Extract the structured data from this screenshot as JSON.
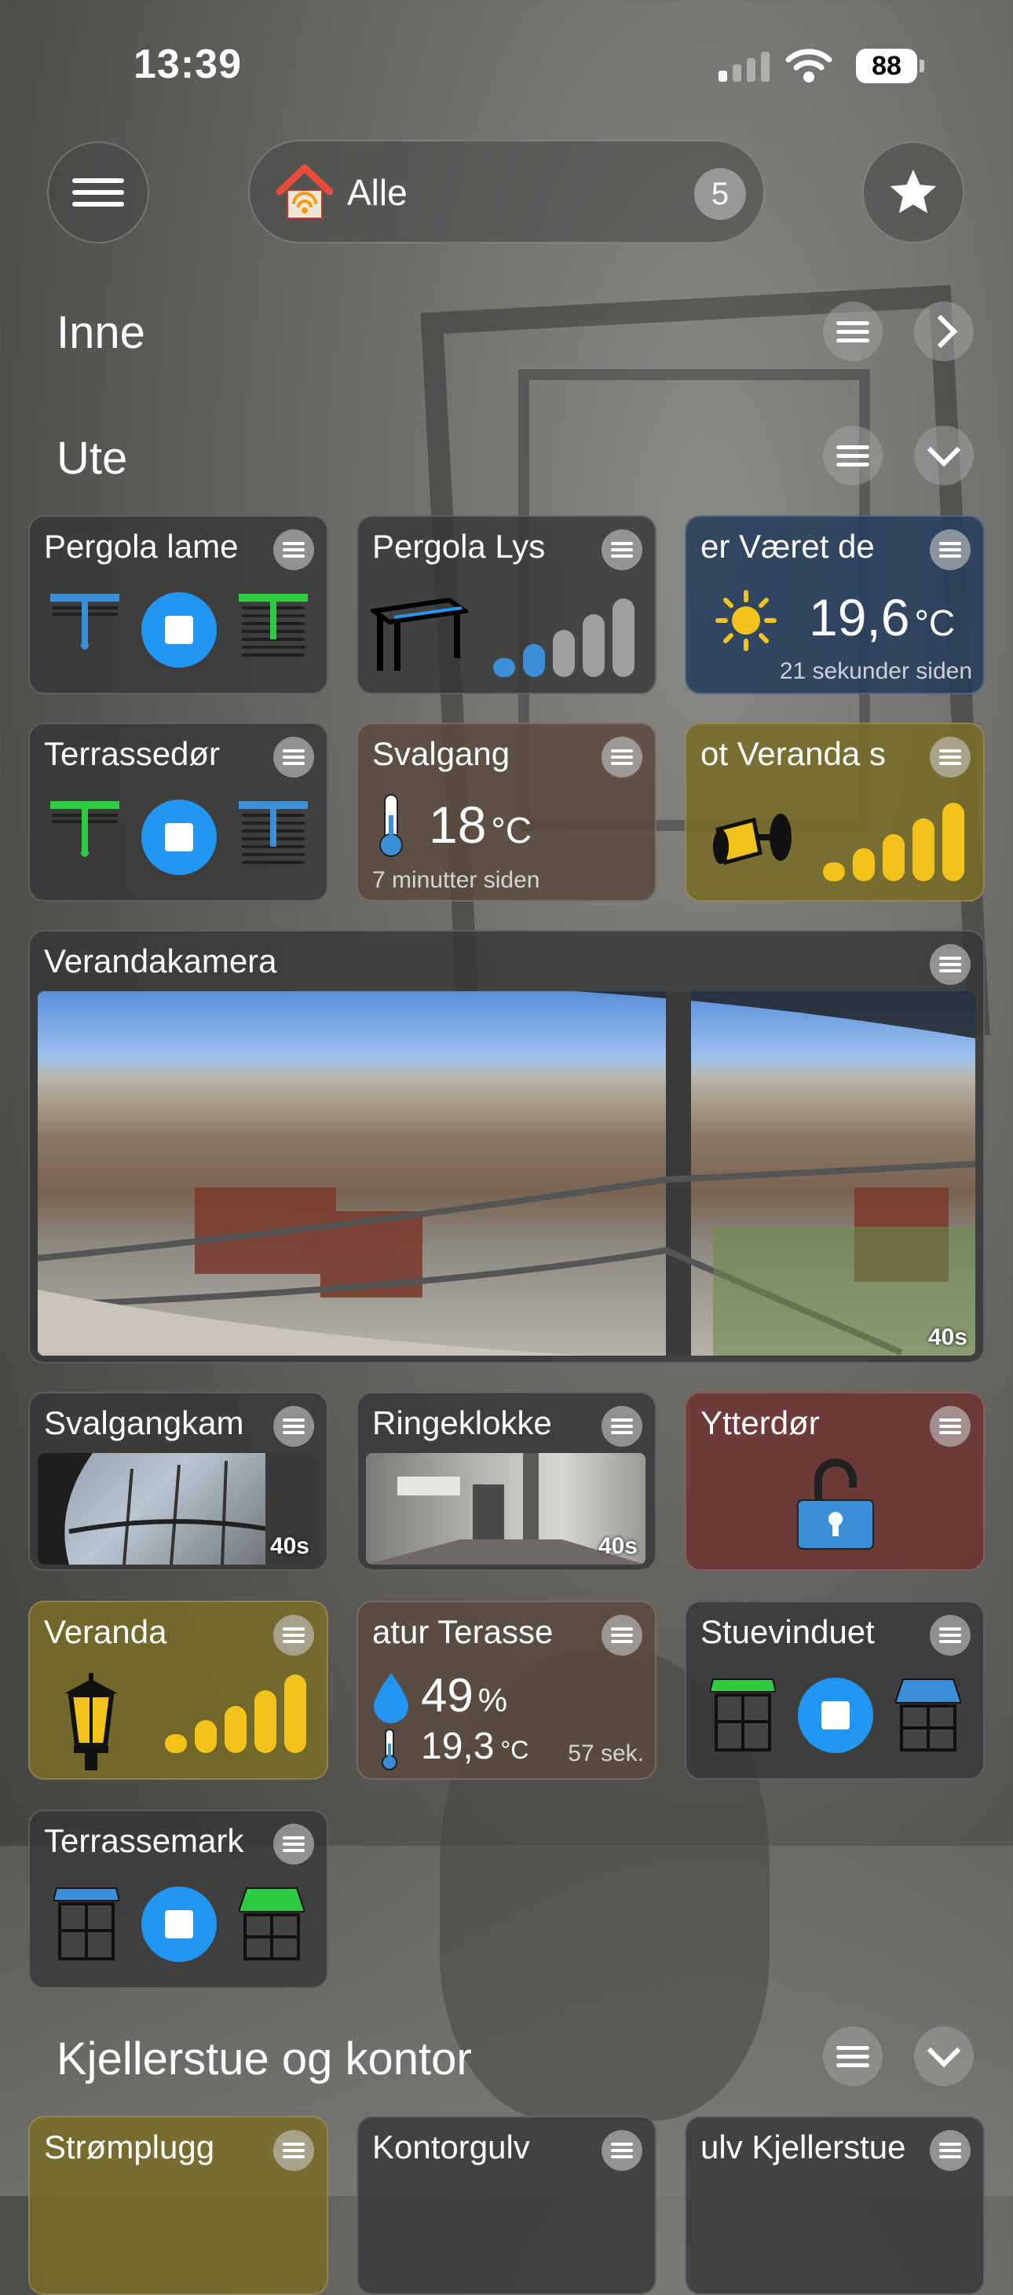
{
  "status": {
    "time": "13:39",
    "battery": "88"
  },
  "topbar": {
    "home_label": "Alle",
    "home_count": "5"
  },
  "sections": {
    "inne": "Inne",
    "ute": "Ute",
    "kjeller": "Kjellerstue og kontor"
  },
  "tiles": {
    "pergola_lame": {
      "title": "Pergola lame"
    },
    "pergola_lys": {
      "title": "Pergola Lys"
    },
    "weather": {
      "title": "er  Været de",
      "value": "19,6",
      "unit": "°C",
      "age": "21 sekunder siden"
    },
    "terrassedor": {
      "title": "Terrassedør"
    },
    "svalgang": {
      "title": "Svalgang",
      "value": "18",
      "unit": "°C",
      "age": "7 minutter siden"
    },
    "veranda_spot": {
      "title": "ot  Veranda s"
    },
    "verandakamera": {
      "title": "Verandakamera",
      "age": "40s"
    },
    "svalgangkam": {
      "title": "Svalgangkam",
      "age": "40s"
    },
    "ringeklokke": {
      "title": "Ringeklokke",
      "age": "40s"
    },
    "ytterdor": {
      "title": "Ytterdør"
    },
    "veranda": {
      "title": "Veranda"
    },
    "terasse": {
      "title": "atur  Terasse",
      "humidity": "49",
      "humidity_unit": "%",
      "temp": "19,3",
      "temp_unit": "°C",
      "age": "57 sek."
    },
    "stuevinduet": {
      "title": "Stuevinduet"
    },
    "terrassemark": {
      "title": "Terrassemark"
    },
    "stromplugg": {
      "title": "Strømplugg"
    },
    "kontorgulv": {
      "title": "Kontorgulv"
    },
    "kjellerstue": {
      "title": "ulv  Kjellerstue"
    }
  },
  "colors": {
    "accent_blue": "#2196f3",
    "light_yellow": "#f2c31a",
    "awning_green": "#2ecc40",
    "awning_blue": "#3b8fd9"
  }
}
